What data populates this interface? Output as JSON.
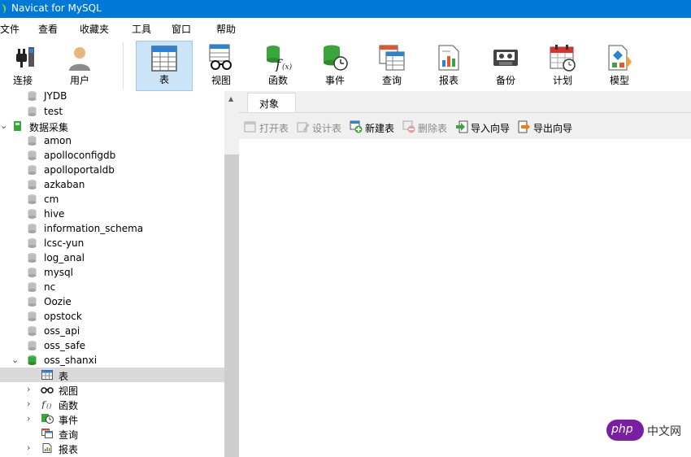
{
  "window": {
    "title": "Navicat for MySQL"
  },
  "menu": [
    "文件",
    "查看",
    "收藏夹",
    "工具",
    "窗口",
    "帮助"
  ],
  "toolbar": [
    {
      "label": "连接",
      "icon": "plug-icon"
    },
    {
      "label": "用户",
      "icon": "user-icon"
    },
    {
      "label": "表",
      "icon": "table-icon",
      "active": true
    },
    {
      "label": "视图",
      "icon": "view-glasses-icon"
    },
    {
      "label": "函数",
      "icon": "function-icon"
    },
    {
      "label": "事件",
      "icon": "event-clock-icon"
    },
    {
      "label": "查询",
      "icon": "query-icon"
    },
    {
      "label": "报表",
      "icon": "report-icon"
    },
    {
      "label": "备份",
      "icon": "backup-tape-icon"
    },
    {
      "label": "计划",
      "icon": "schedule-calendar-icon"
    },
    {
      "label": "模型",
      "icon": "model-icon"
    }
  ],
  "tree": {
    "items": [
      {
        "label": "JYDB",
        "type": "db"
      },
      {
        "label": "test",
        "type": "db"
      },
      {
        "label": "数据采集",
        "type": "connection",
        "expanded": true
      },
      {
        "label": "amon",
        "type": "db"
      },
      {
        "label": "apolloconfigdb",
        "type": "db"
      },
      {
        "label": "apolloportaldb",
        "type": "db"
      },
      {
        "label": "azkaban",
        "type": "db"
      },
      {
        "label": "cm",
        "type": "db"
      },
      {
        "label": "hive",
        "type": "db"
      },
      {
        "label": "information_schema",
        "type": "db"
      },
      {
        "label": "lcsc-yun",
        "type": "db"
      },
      {
        "label": "log_anal",
        "type": "db"
      },
      {
        "label": "mysql",
        "type": "db"
      },
      {
        "label": "nc",
        "type": "db"
      },
      {
        "label": "Oozie",
        "type": "db"
      },
      {
        "label": "opstock",
        "type": "db"
      },
      {
        "label": "oss_api",
        "type": "db"
      },
      {
        "label": "oss_safe",
        "type": "db"
      },
      {
        "label": "oss_shanxi",
        "type": "db-open",
        "expanded": true
      },
      {
        "label": "表",
        "type": "tables",
        "selected": true
      },
      {
        "label": "视图",
        "type": "views"
      },
      {
        "label": "函数",
        "type": "functions"
      },
      {
        "label": "事件",
        "type": "events"
      },
      {
        "label": "查询",
        "type": "queries"
      },
      {
        "label": "报表",
        "type": "reports"
      }
    ]
  },
  "content": {
    "tab_label": "对象",
    "object_toolbar": [
      {
        "label": "打开表",
        "icon": "open-table-icon",
        "enabled": false
      },
      {
        "label": "设计表",
        "icon": "design-table-icon",
        "enabled": false
      },
      {
        "label": "新建表",
        "icon": "new-table-icon",
        "enabled": true
      },
      {
        "label": "删除表",
        "icon": "delete-table-icon",
        "enabled": false
      },
      {
        "label": "导入向导",
        "icon": "import-wizard-icon",
        "enabled": true
      },
      {
        "label": "导出向导",
        "icon": "export-wizard-icon",
        "enabled": true
      }
    ]
  },
  "watermark": {
    "logo": "php",
    "text": "中文网"
  },
  "colors": {
    "titlebar": "#0078d7",
    "active_tool": "#cce4f7",
    "selected_row": "#d9d9d9",
    "db_green": "#3aa53a"
  }
}
